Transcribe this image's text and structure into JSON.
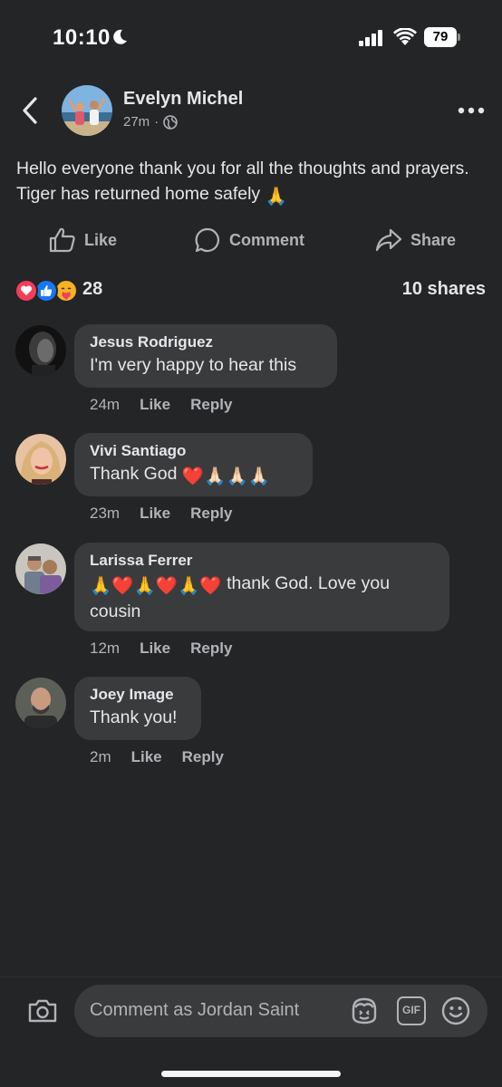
{
  "status_bar": {
    "time": "10:10",
    "battery_level": "79"
  },
  "post": {
    "author_name": "Evelyn Michel",
    "time_ago": "27m",
    "privacy_separator": "·",
    "text": "Hello everyone thank you for all the thoughts and prayers. Tiger has returned home safely",
    "text_emoji": "🙏",
    "actions": {
      "like": "Like",
      "comment": "Comment",
      "share": "Share"
    },
    "reaction_count": "28",
    "shares": "10 shares"
  },
  "comments": [
    {
      "name": "Jesus Rodriguez",
      "text": "I'm very happy to hear this",
      "emoji": "",
      "time": "24m",
      "like": "Like",
      "reply": "Reply"
    },
    {
      "name": "Vivi Santiago",
      "text": "Thank God",
      "emoji": "❤️🙏🏻🙏🏻🙏🏻",
      "time": "23m",
      "like": "Like",
      "reply": "Reply"
    },
    {
      "name": "Larissa Ferrer",
      "emoji": "🙏❤️🙏❤️🙏❤️",
      "text": "thank God. Love you cousin",
      "time": "12m",
      "like": "Like",
      "reply": "Reply"
    },
    {
      "name": "Joey Image",
      "text": "Thank you!",
      "emoji": "",
      "time": "2m",
      "like": "Like",
      "reply": "Reply"
    }
  ],
  "composer": {
    "placeholder": "Comment as Jordan Saint",
    "gif_label": "GIF"
  },
  "colors": {
    "background": "#242526",
    "bubble": "#3a3b3c",
    "secondary_text": "#b0b3b8",
    "primary_text": "#e4e6eb",
    "love": "#f33e58",
    "like": "#1877f2"
  },
  "icons": [
    "back-chevron-icon",
    "globe-icon",
    "more-icon",
    "like-thumb-icon",
    "comment-bubble-icon",
    "share-arrow-icon",
    "love-reaction-icon",
    "like-reaction-icon",
    "care-reaction-icon",
    "camera-icon",
    "avatar-sticker-icon",
    "gif-icon",
    "emoji-icon"
  ]
}
